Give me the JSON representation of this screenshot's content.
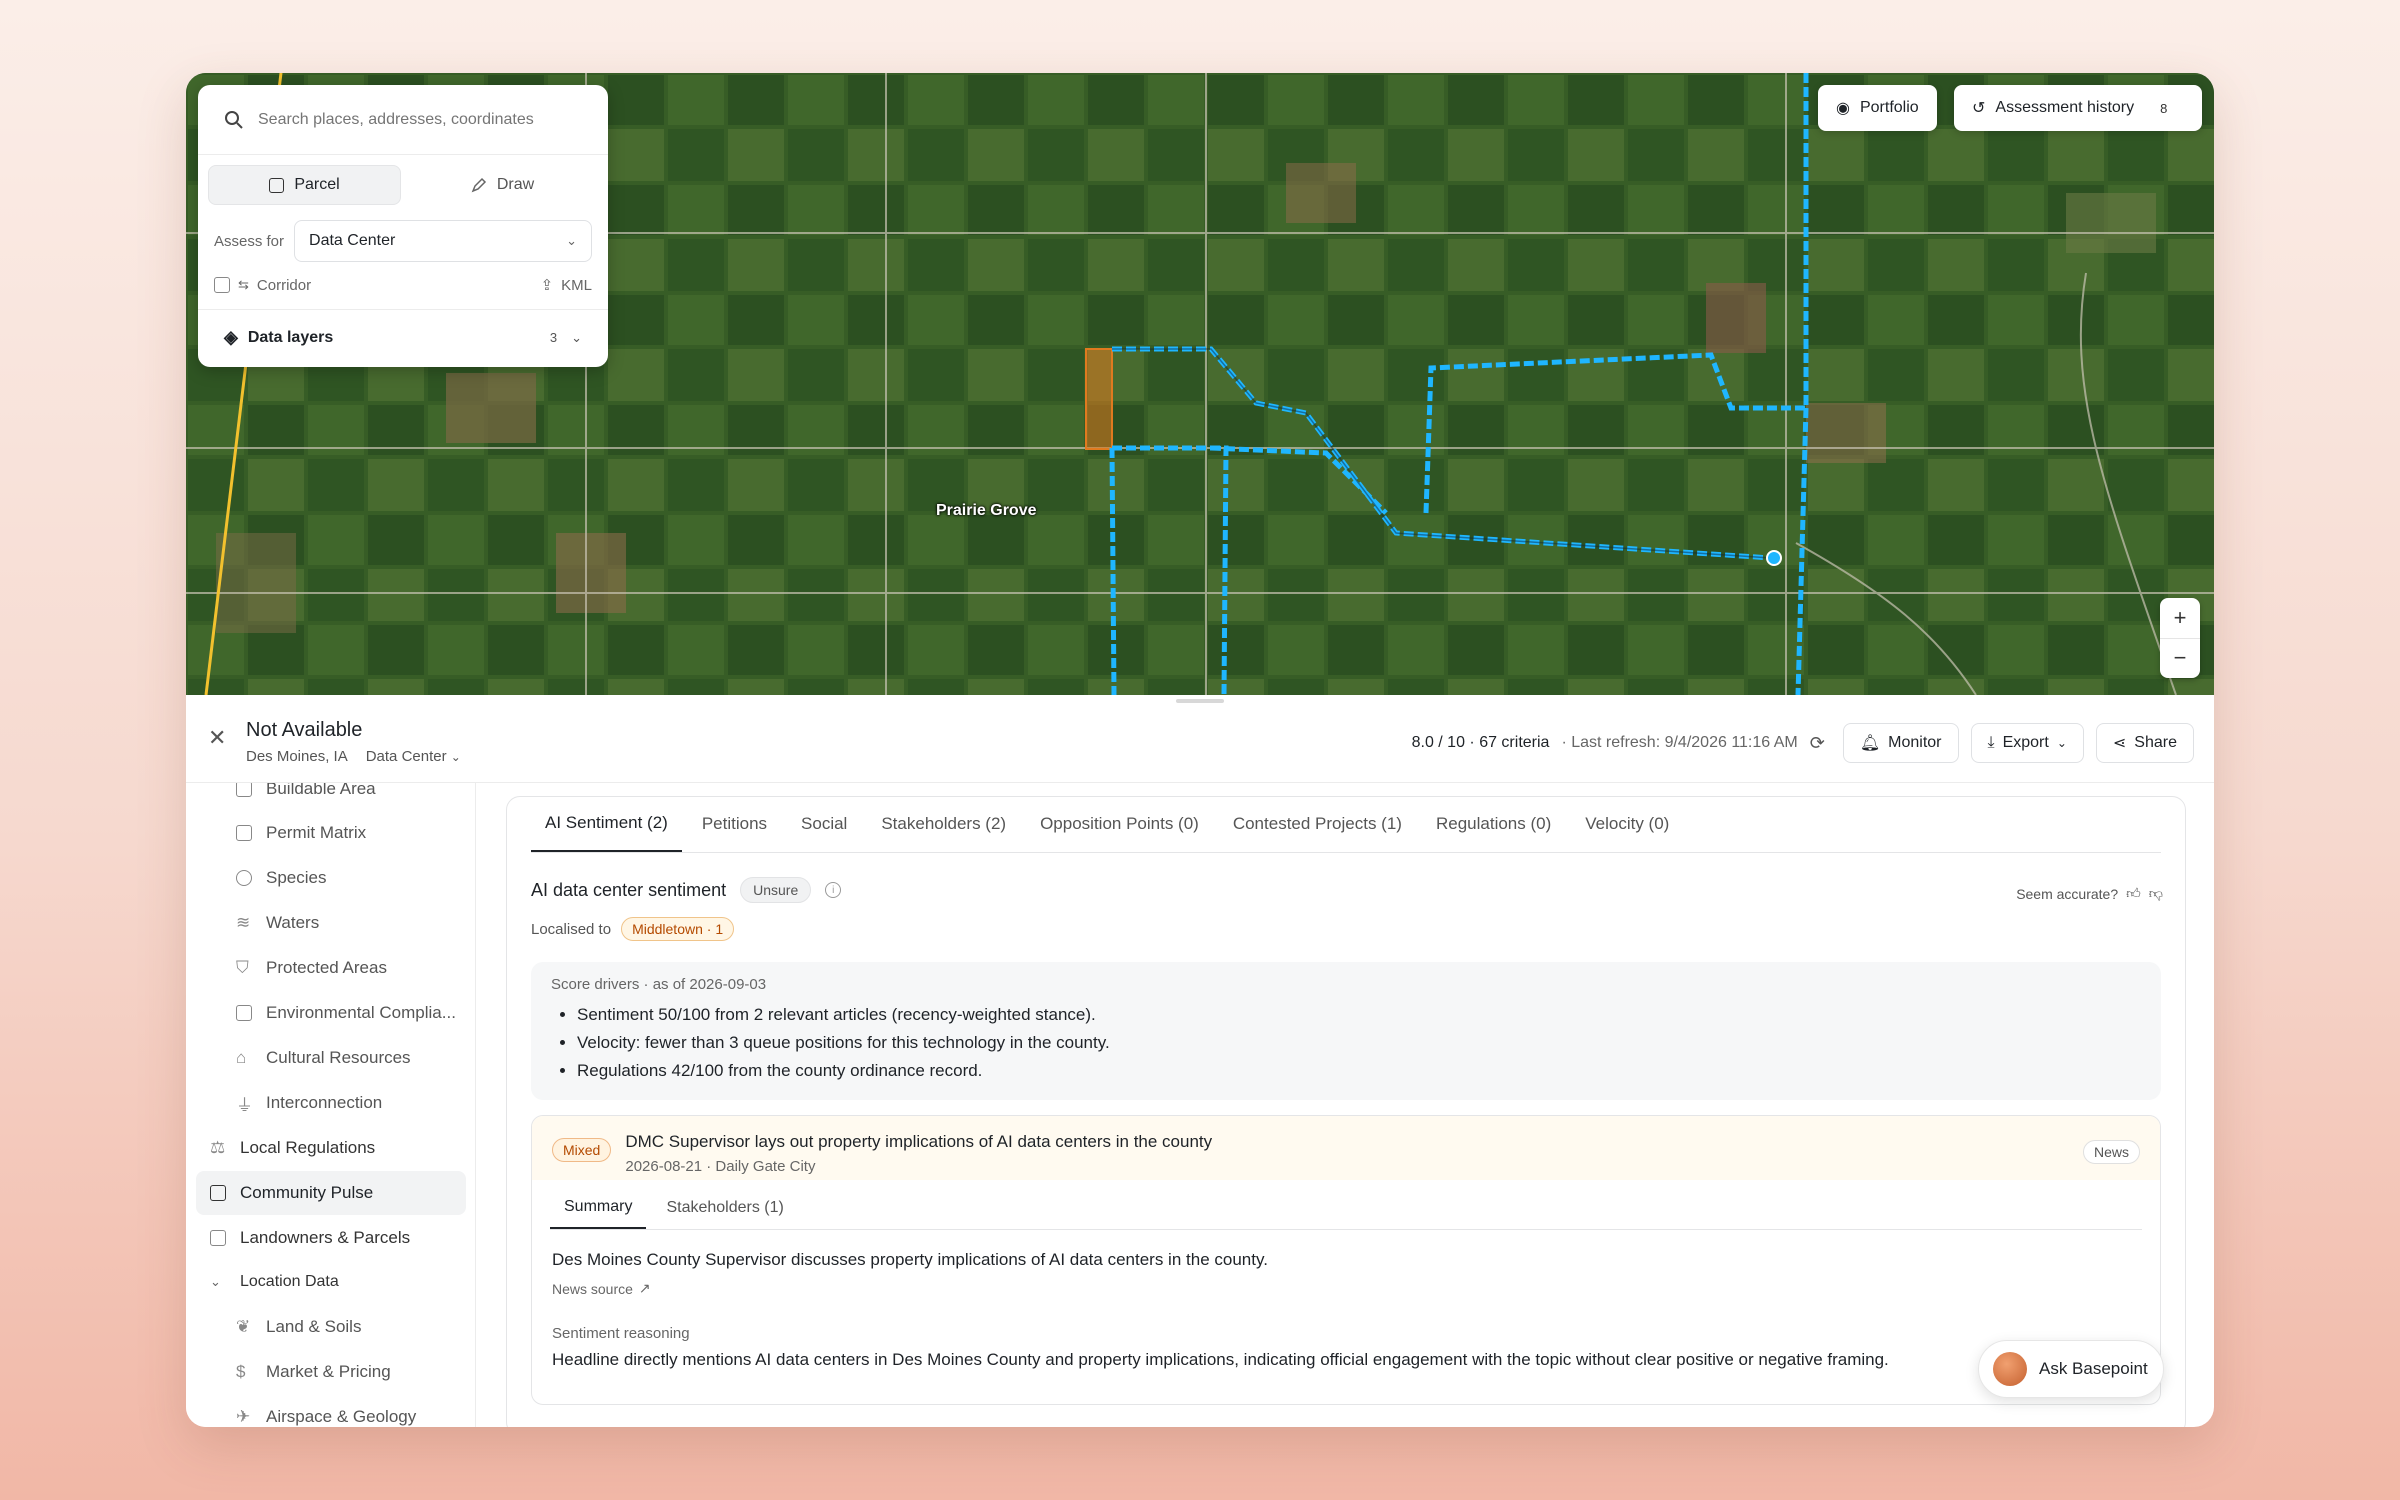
{
  "map": {
    "place_label": "Prairie Grove",
    "search": {
      "placeholder": "Search places, addresses, coordinates"
    },
    "modes": [
      {
        "label": "Parcel",
        "active": true
      },
      {
        "label": "Draw",
        "active": false
      }
    ],
    "assess_for": {
      "label": "Assess for",
      "value": "Data Center"
    },
    "corridor": {
      "label": "Corridor",
      "checked": false
    },
    "kml_label": "KML",
    "data_layers": {
      "label": "Data layers",
      "count": "3"
    },
    "buttons": {
      "portfolio": "Portfolio",
      "history": "Assessment history",
      "history_count": "8"
    },
    "zoom": {
      "in": "+",
      "out": "−"
    }
  },
  "header": {
    "title": "Not Available",
    "location": "Des Moines, IA",
    "use": "Data Center",
    "score": "8.0 / 10 · 67 criteria",
    "refresh": "· Last refresh: 9/4/2026 11:16 AM",
    "monitor": "Monitor",
    "export": "Export",
    "share": "Share"
  },
  "sidebar": {
    "items": [
      {
        "label": "Buildable Area",
        "sub": true
      },
      {
        "label": "Permit Matrix",
        "sub": true
      },
      {
        "label": "Species",
        "sub": true
      },
      {
        "label": "Waters",
        "sub": true
      },
      {
        "label": "Protected Areas",
        "sub": true
      },
      {
        "label": "Environmental Complia...",
        "sub": true
      },
      {
        "label": "Cultural Resources",
        "sub": true
      },
      {
        "label": "Interconnection",
        "sub": true
      },
      {
        "label": "Local Regulations",
        "sub": false
      },
      {
        "label": "Community Pulse",
        "sub": false,
        "active": true
      },
      {
        "label": "Landowners & Parcels",
        "sub": false
      },
      {
        "label": "Location Data",
        "sub": false,
        "group": true
      },
      {
        "label": "Land & Soils",
        "sub": true
      },
      {
        "label": "Market & Pricing",
        "sub": true
      },
      {
        "label": "Airspace & Geology",
        "sub": true
      }
    ]
  },
  "content": {
    "tabs": [
      {
        "label": "AI Sentiment (2)",
        "active": true
      },
      {
        "label": "Petitions"
      },
      {
        "label": "Social"
      },
      {
        "label": "Stakeholders (2)"
      },
      {
        "label": "Opposition Points (0)"
      },
      {
        "label": "Contested Projects (1)"
      },
      {
        "label": "Regulations (0)"
      },
      {
        "label": "Velocity (0)"
      }
    ],
    "sentiment_title": "AI data center sentiment",
    "sentiment_status": "Unsure",
    "seem_accurate": "Seem accurate?",
    "localised_label": "Localised to",
    "localised_value": "Middletown · 1",
    "drivers_header": "Score drivers · as of 2026-09-03",
    "drivers": [
      "Sentiment 50/100 from 2 relevant articles (recency-weighted stance).",
      "Velocity: fewer than 3 queue positions for this technology in the county.",
      "Regulations 42/100 from the county ordinance record."
    ],
    "article": {
      "badge": "Mixed",
      "title": "DMC Supervisor lays out property implications of AI data centers in the county",
      "meta": "2026-08-21 · Daily Gate City",
      "type": "News",
      "tabs": [
        {
          "label": "Summary",
          "active": true
        },
        {
          "label": "Stakeholders (1)"
        }
      ],
      "summary": "Des Moines County Supervisor discusses property implications of AI data centers in the county.",
      "source": "News source",
      "reasoning_label": "Sentiment reasoning",
      "reasoning": "Headline directly mentions AI data centers in Des Moines County and property implications, indicating official engagement with the topic without clear positive or negative framing."
    }
  },
  "assistant": {
    "label": "Ask Basepoint"
  },
  "colors": {
    "route": "#1fb6ff",
    "parcel": "#e07a1f",
    "highway": "#f2c12e"
  }
}
